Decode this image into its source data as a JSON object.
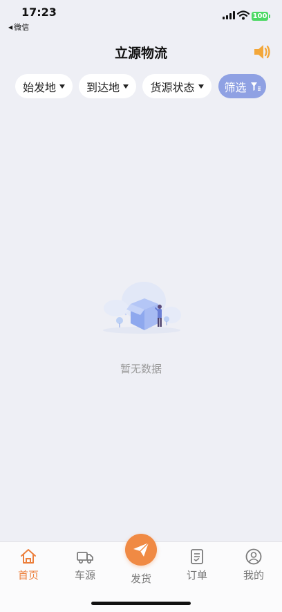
{
  "status_bar": {
    "time": "17:23",
    "back_app": "微信",
    "battery": "100"
  },
  "header": {
    "title": "立源物流",
    "speaker_icon": "speaker-icon"
  },
  "filters": {
    "origin": "始发地",
    "destination": "到达地",
    "cargo_status": "货源状态",
    "screen": "筛选"
  },
  "empty_state": {
    "text": "暂无数据"
  },
  "tabbar": {
    "items": [
      {
        "label": "首页",
        "icon": "home-icon",
        "active": true
      },
      {
        "label": "车源",
        "icon": "truck-icon",
        "active": false
      },
      {
        "label": "发货",
        "icon": "paper-plane-icon",
        "active": false
      },
      {
        "label": "订单",
        "icon": "order-list-icon",
        "active": false
      },
      {
        "label": "我的",
        "icon": "user-icon",
        "active": false
      }
    ]
  },
  "colors": {
    "accent": "#ec7f3c",
    "filter_button": "#8fa1e3",
    "background": "#eeeff5"
  }
}
